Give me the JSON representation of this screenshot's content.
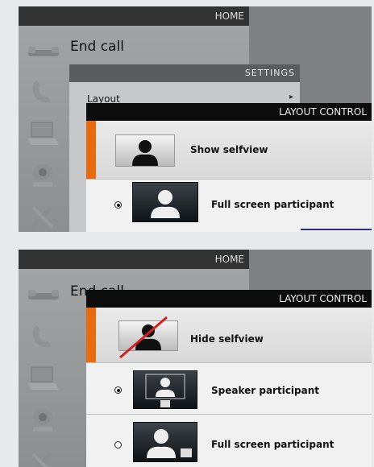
{
  "top_screen": {
    "home_title": "HOME",
    "end_call": "End call",
    "settings_title": "SETTINGS",
    "layout_item": "Layout",
    "layout_control_title": "LAYOUT CONTROL",
    "selfview_label": "Show selfview",
    "option_label": "Full screen participant",
    "icons": [
      "handset-icon",
      "phone-icon",
      "laptop-icon",
      "camera-icon",
      "tools-icon"
    ]
  },
  "bottom_screen": {
    "home_title": "HOME",
    "end_call": "End call",
    "layout_control_title": "LAYOUT CONTROL",
    "selfview_label": "Hide selfview",
    "option1_label": "Speaker participant",
    "option2_label": "Full screen participant",
    "icons": [
      "handset-icon",
      "phone-icon",
      "laptop-icon",
      "camera-icon",
      "tools-icon"
    ]
  },
  "colors": {
    "accent": "#e86b10",
    "bar": "#0c0c0c",
    "strike": "#d42020"
  }
}
